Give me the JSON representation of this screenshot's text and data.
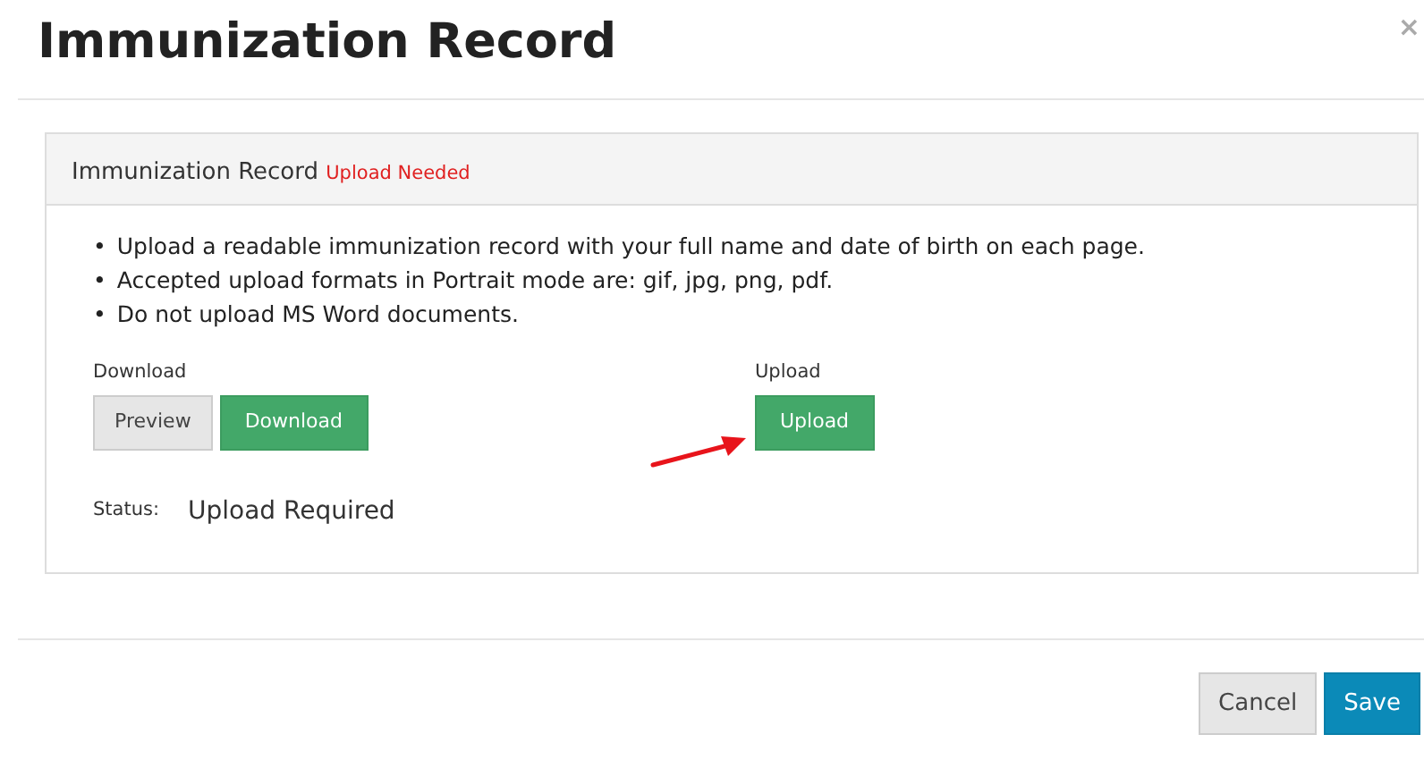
{
  "modal": {
    "title": "Immunization Record",
    "close": "×"
  },
  "panel": {
    "title": "Immunization Record",
    "badge": "Upload Needed",
    "instructions": [
      {
        "bullet": "•",
        "text": "Upload a readable immunization record with your full name and date of birth on each page."
      },
      {
        "bullet": "•",
        "text": "Accepted upload formats in Portrait mode are: gif, jpg, png, pdf."
      },
      {
        "bullet": "•",
        "text": "Do not upload MS Word documents."
      }
    ],
    "download": {
      "label": "Download",
      "buttons": [
        {
          "label": "Preview",
          "kind": "secondary"
        },
        {
          "label": "Download",
          "kind": "success"
        }
      ]
    },
    "upload": {
      "label": "Upload",
      "button": "Upload"
    },
    "status": {
      "label": "Status:",
      "value": "Upload Required"
    }
  },
  "footer": {
    "buttons": [
      {
        "label": "Cancel",
        "kind": "secondary"
      },
      {
        "label": "Save",
        "kind": "primary"
      }
    ]
  }
}
